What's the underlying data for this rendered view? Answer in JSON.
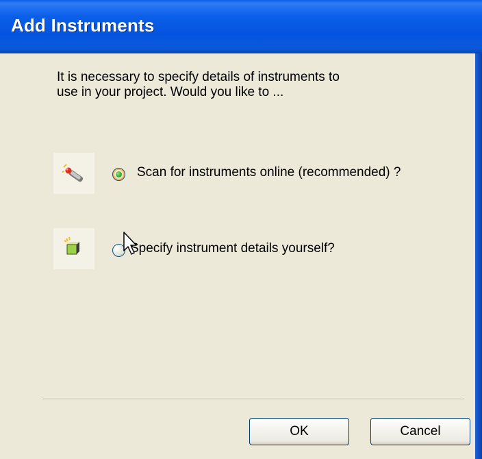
{
  "window": {
    "title": "Add Instruments"
  },
  "intro": {
    "line1": "It is necessary to specify details of instruments to",
    "line2": "use in your project.  Would you like to ..."
  },
  "options": [
    {
      "label": "Scan for instruments online (recommended) ?",
      "checked": true,
      "icon": "scan-probe-icon"
    },
    {
      "label": "Specify instrument details yourself?",
      "checked": false,
      "icon": "instrument-box-icon"
    }
  ],
  "buttons": {
    "ok": "OK",
    "cancel": "Cancel"
  }
}
